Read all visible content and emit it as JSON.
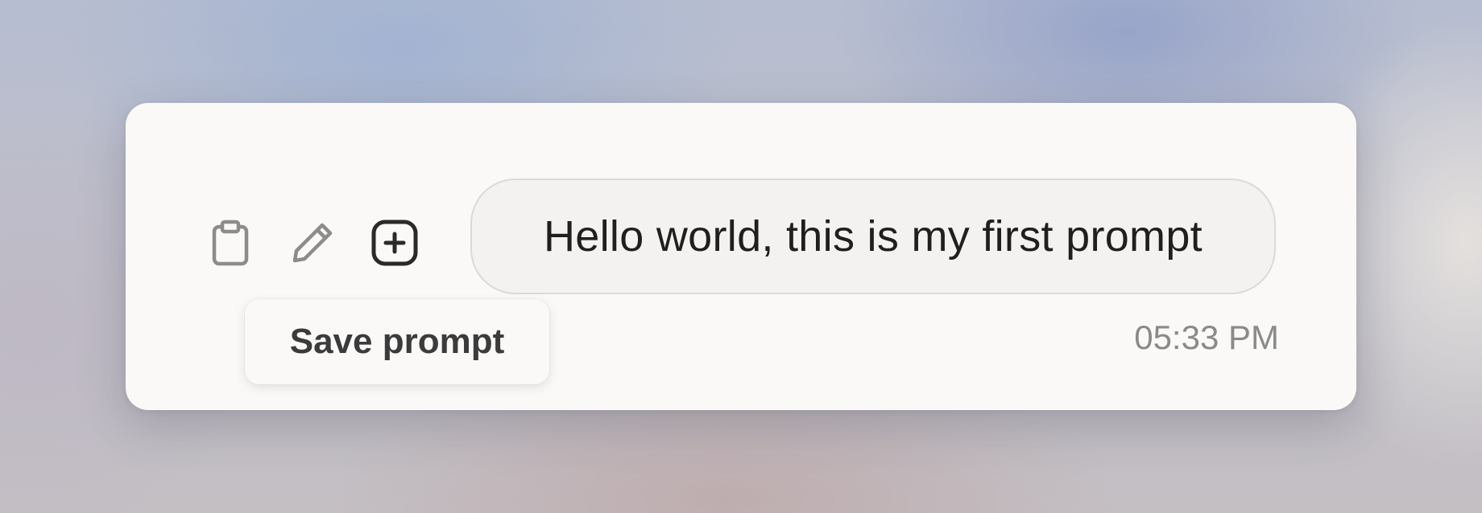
{
  "message": {
    "text": "Hello world, this is my first prompt",
    "timestamp": "05:33 PM"
  },
  "actions": [
    {
      "name": "copy",
      "icon": "clipboard-icon"
    },
    {
      "name": "edit",
      "icon": "pencil-icon"
    },
    {
      "name": "save",
      "icon": "plus-square-icon"
    }
  ],
  "tooltip": {
    "label": "Save prompt"
  },
  "colors": {
    "card_background": "#faf9f7",
    "bubble_background": "#f3f2f0",
    "bubble_border": "#dcdad6",
    "text_primary": "#1f1f1f",
    "text_muted": "#8a8a8a",
    "icon_muted": "#8c8c8c",
    "icon_active": "#2a2a2a"
  }
}
